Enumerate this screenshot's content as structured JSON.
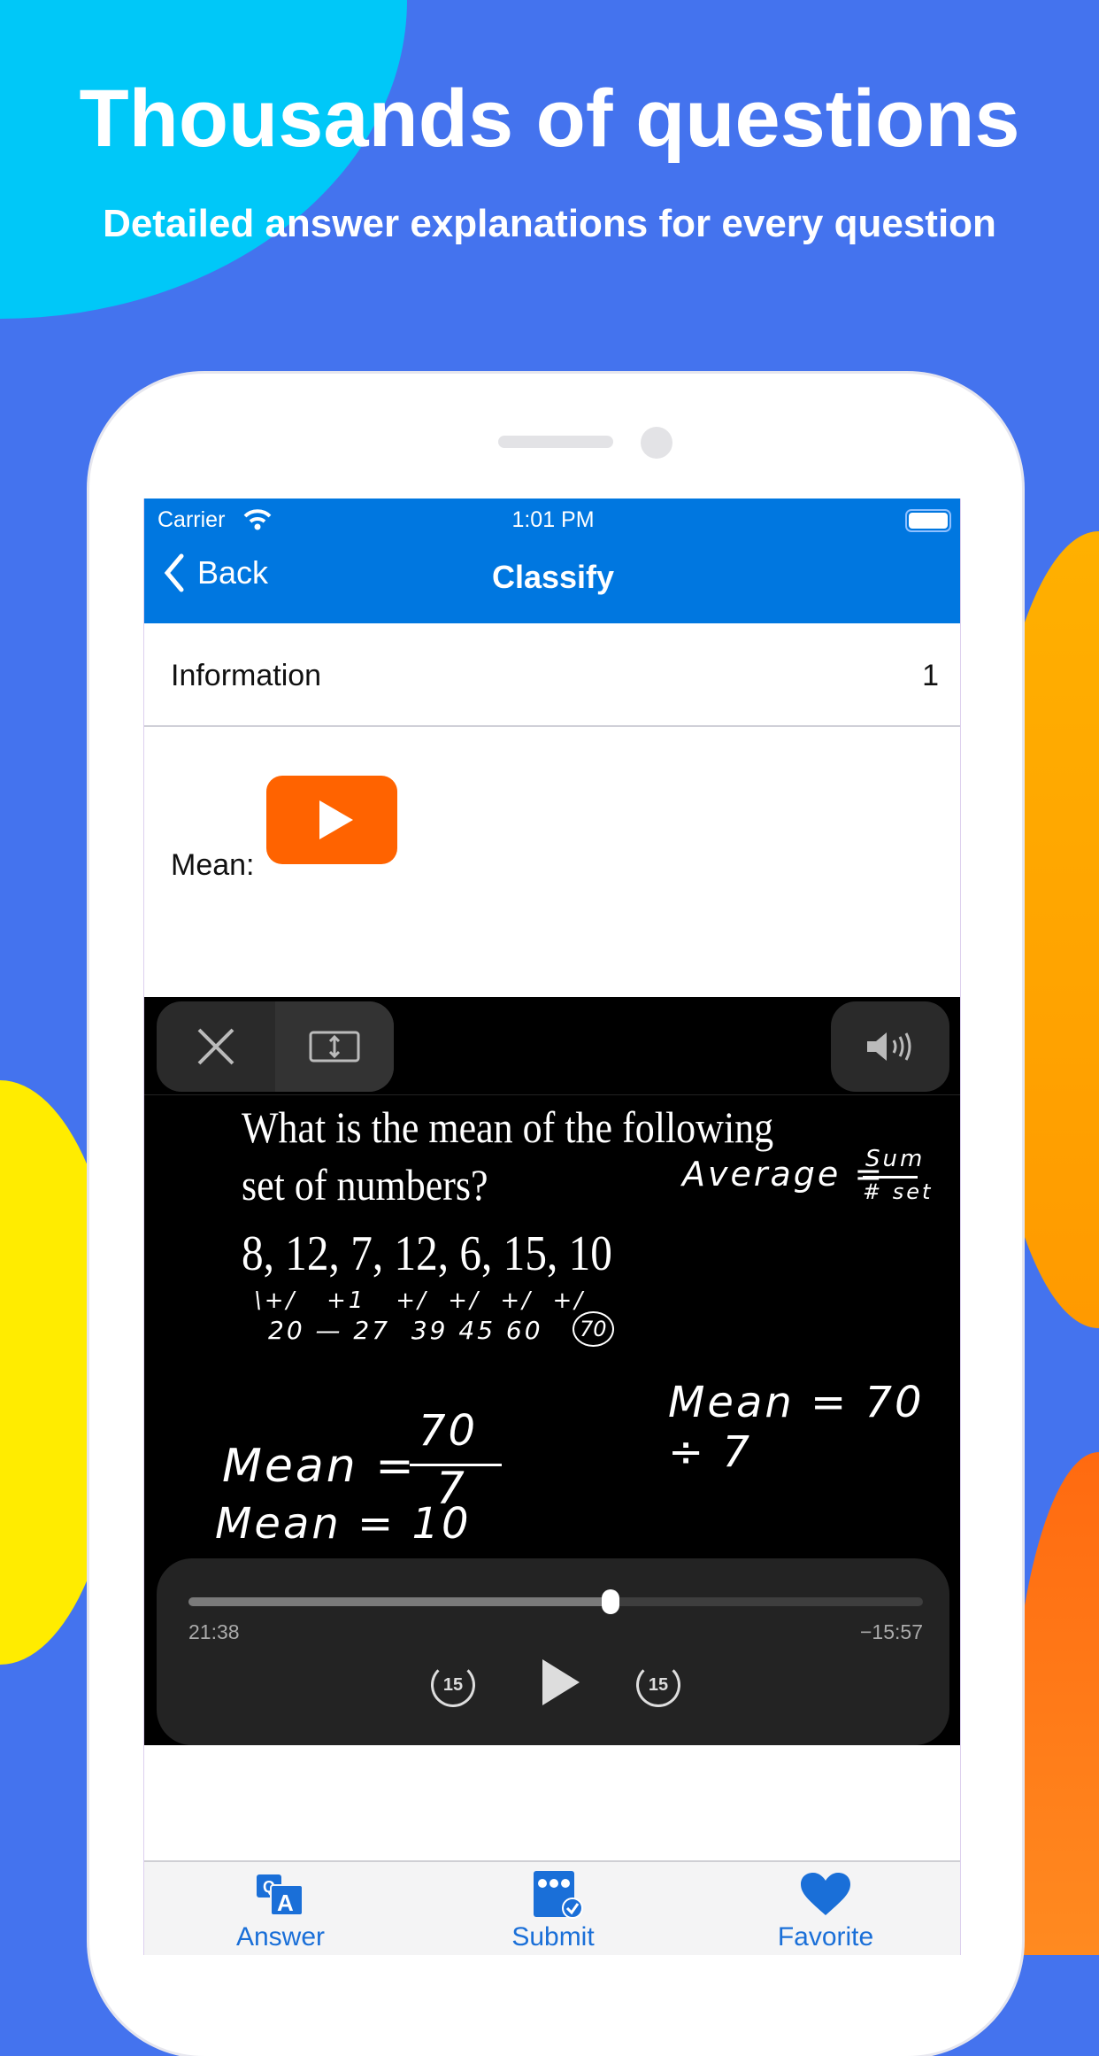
{
  "promo": {
    "headline": "Thousands of questions",
    "subheadline": "Detailed answer explanations for every question"
  },
  "colors": {
    "background": "#4473ee",
    "accent_cyan": "#00c8f8",
    "accent_orange": "#ffa000",
    "accent_yellow": "#ffe800",
    "nav_blue": "#0077e0",
    "tab_blue": "#1a6fd8",
    "play_orange": "#ff6300"
  },
  "status_bar": {
    "carrier": "Carrier",
    "time": "1:01 PM"
  },
  "nav": {
    "back_label": "Back",
    "title": "Classify"
  },
  "info_row": {
    "label": "Information",
    "value": "1"
  },
  "content": {
    "mean_label": "Mean:"
  },
  "video": {
    "question_line1": "What is the mean of the following",
    "question_line2": "set of numbers?",
    "numbers": "8, 12, 7, 12, 6, 15, 10",
    "hand_average": "Average =",
    "hand_sum": "Sum",
    "hand_set": "# set",
    "hand_plus_row": "\\+/   +1   +/  +/  +/  +/",
    "hand_partials": "20 — 27  39 45 60",
    "hand_total": "70",
    "hand_mean_div": "Mean = 70 ÷ 7",
    "hand_mean_frac_label": "Mean =",
    "hand_frac_num": "70",
    "hand_frac_den": "7",
    "hand_mean_result": "Mean = 10",
    "elapsed": "21:38",
    "remaining": "−15:57",
    "progress": 0.575,
    "skip_back_label": "15",
    "skip_forward_label": "15"
  },
  "tabs": [
    {
      "label": "Answer",
      "icon": "qa-icon"
    },
    {
      "label": "Submit",
      "icon": "submit-check-icon"
    },
    {
      "label": "Favorite",
      "icon": "heart-icon"
    }
  ]
}
